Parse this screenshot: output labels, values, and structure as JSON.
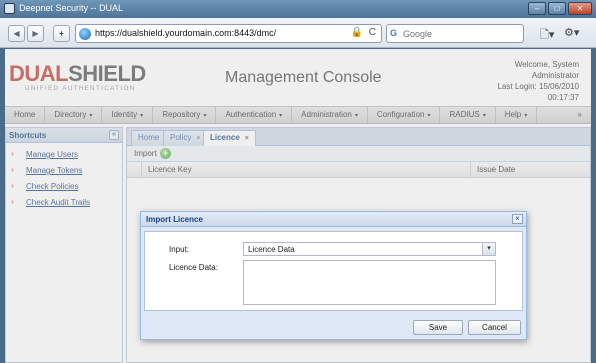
{
  "window": {
    "title": "Deepnet Security -- DUAL",
    "minimize": "–",
    "maximize": "□",
    "close": "✕"
  },
  "browser": {
    "back": "◀",
    "forward": "▶",
    "new_tab": "+",
    "url": "https://dualshield.yourdomain.com:8443/dmc/",
    "lock": "🔒",
    "reload": "C",
    "search_engine": "G",
    "search_placeholder": "Google",
    "page_menu": "🗋▾",
    "tools_menu": "⚙▾"
  },
  "header": {
    "logo_dual": "DUAL",
    "logo_shield": "SHIELD",
    "logo_sub": "UNIFIED AUTHENTICATION",
    "console_title": "Management Console",
    "welcome_line1": "Welcome, System",
    "welcome_line2": "Administrator",
    "last_login": "Last Login: 15/06/2010",
    "time": "00:17:37"
  },
  "menu": {
    "items": [
      {
        "label": "Home",
        "dropdown": false
      },
      {
        "label": "Directory",
        "dropdown": true
      },
      {
        "label": "Identity",
        "dropdown": true
      },
      {
        "label": "Repository",
        "dropdown": true
      },
      {
        "label": "Authentication",
        "dropdown": true
      },
      {
        "label": "Administration",
        "dropdown": true
      },
      {
        "label": "Configuration",
        "dropdown": true
      },
      {
        "label": "RADIUS",
        "dropdown": true
      },
      {
        "label": "Help",
        "dropdown": true
      }
    ],
    "overflow": "»",
    "arrow": "▾"
  },
  "sidebar": {
    "title": "Shortcuts",
    "collapse": "«",
    "chevron": "›",
    "items": [
      "Manage Users",
      "Manage Tokens",
      "Check Policies",
      "Check Audit Trails"
    ]
  },
  "tabs": [
    {
      "label": "Home",
      "closable": false,
      "active": false
    },
    {
      "label": "Policy",
      "closable": true,
      "active": false
    },
    {
      "label": "Licence",
      "closable": true,
      "active": true
    }
  ],
  "tab_close": "×",
  "grid": {
    "import_label": "Import",
    "import_icon": "+",
    "columns": [
      "Licence Key",
      "Issue Date"
    ]
  },
  "dialog": {
    "title": "Import Licence",
    "close": "×",
    "input_label": "Input:",
    "input_value": "Licence Data",
    "select_arrow": "▾",
    "licence_label": "Licence Data:",
    "licence_value": "",
    "save": "Save",
    "cancel": "Cancel"
  }
}
